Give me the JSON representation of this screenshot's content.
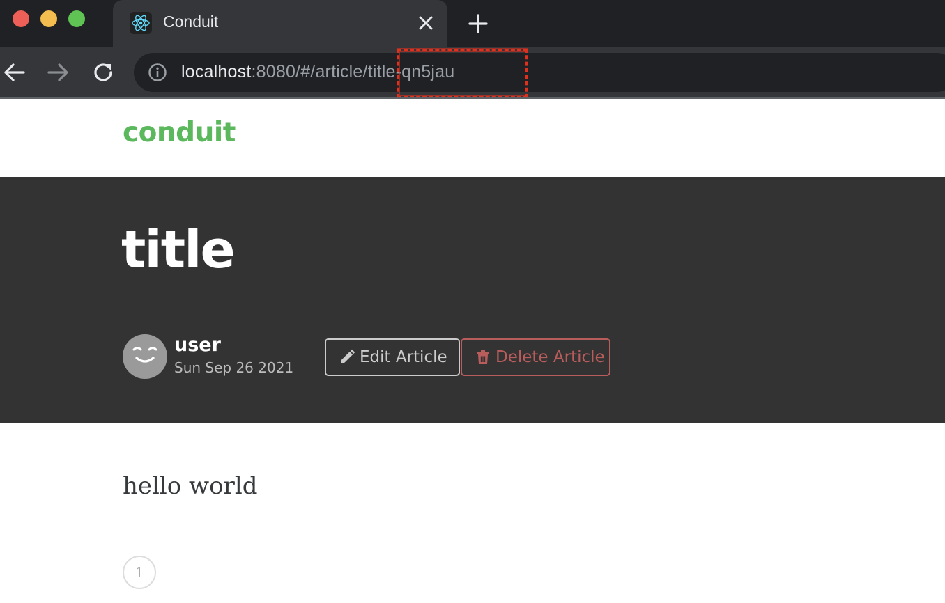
{
  "browser": {
    "tab": {
      "title": "Conduit",
      "favicon": "react-logo-icon"
    },
    "url": {
      "host": "localhost",
      "rest": ":8080/#/article/title-qn5jau"
    },
    "icons": {
      "back": "arrow-left-icon",
      "forward": "arrow-right-icon",
      "reload": "reload-icon",
      "info": "info-icon",
      "close": "close-icon",
      "new_tab": "plus-icon"
    }
  },
  "colors": {
    "brand": "#5cb85c",
    "banner": "#333333",
    "danger": "#b85c5c",
    "highlight": "#e0301e"
  },
  "navbar": {
    "brand": "conduit"
  },
  "article": {
    "title": "title",
    "author": "user",
    "date": "Sun Sep 26 2021",
    "edit_label": "Edit Article",
    "delete_label": "Delete Article",
    "body": "hello world",
    "tag": "1"
  }
}
